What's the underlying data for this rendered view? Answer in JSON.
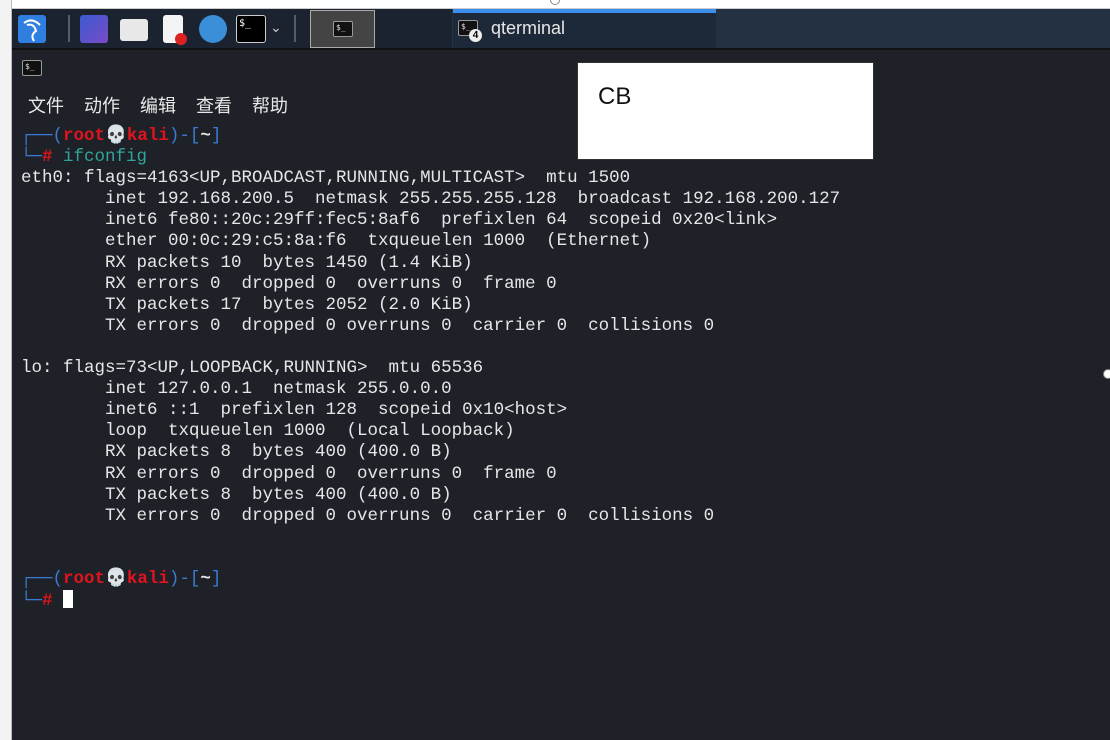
{
  "taskbar": {
    "task_label": "qterminal",
    "task_badge": "4"
  },
  "window": {
    "menu": [
      "文件",
      "动作",
      "编辑",
      "查看",
      "帮助"
    ]
  },
  "overlay": {
    "text": "CB"
  },
  "prompt": {
    "user": "root",
    "host": "kali",
    "dir": "~",
    "symbol": "#"
  },
  "command": "ifconfig",
  "output": [
    "eth0: flags=4163<UP,BROADCAST,RUNNING,MULTICAST>  mtu 1500",
    "        inet 192.168.200.5  netmask 255.255.255.128  broadcast 192.168.200.127",
    "        inet6 fe80::20c:29ff:fec5:8af6  prefixlen 64  scopeid 0x20<link>",
    "        ether 00:0c:29:c5:8a:f6  txqueuelen 1000  (Ethernet)",
    "        RX packets 10  bytes 1450 (1.4 KiB)",
    "        RX errors 0  dropped 0  overruns 0  frame 0",
    "        TX packets 17  bytes 2052 (2.0 KiB)",
    "        TX errors 0  dropped 0 overruns 0  carrier 0  collisions 0",
    "",
    "lo: flags=73<UP,LOOPBACK,RUNNING>  mtu 65536",
    "        inet 127.0.0.1  netmask 255.0.0.0",
    "        inet6 ::1  prefixlen 128  scopeid 0x10<host>",
    "        loop  txqueuelen 1000  (Local Loopback)",
    "        RX packets 8  bytes 400 (400.0 B)",
    "        RX errors 0  dropped 0  overruns 0  frame 0",
    "        TX packets 8  bytes 400 (400.0 B)",
    "        TX errors 0  dropped 0 overruns 0  carrier 0  collisions 0"
  ]
}
